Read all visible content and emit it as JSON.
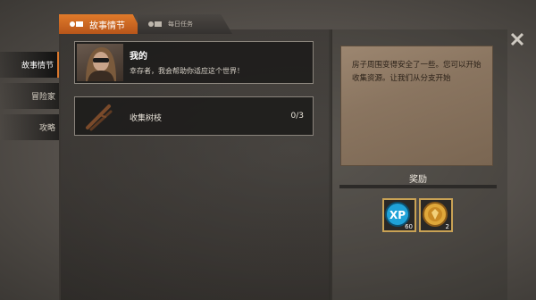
{
  "tabs": [
    {
      "label": "故事情节",
      "icon": "story-icon"
    },
    {
      "label": "每日任务",
      "icon": "daily-icon"
    }
  ],
  "sidebar": {
    "items": [
      {
        "label": "故事情节"
      },
      {
        "label": "冒险家"
      },
      {
        "label": "攻略"
      }
    ]
  },
  "story_card": {
    "title": "我的",
    "text": "幸存者，我会帮助你适应这个世界！"
  },
  "quest_card": {
    "label": "收集树枝",
    "progress": "0/3"
  },
  "note": {
    "text": "房子周围变得安全了一些。您可以开始收集资源。让我们从分支开始"
  },
  "rewards": {
    "label": "奖励",
    "items": [
      {
        "icon": "xp-icon",
        "icon_text": "XP",
        "count": "60"
      },
      {
        "icon": "coin-icon",
        "count": "2"
      }
    ]
  },
  "colors": {
    "accent": "#d9772c",
    "gold": "#c9a255"
  }
}
